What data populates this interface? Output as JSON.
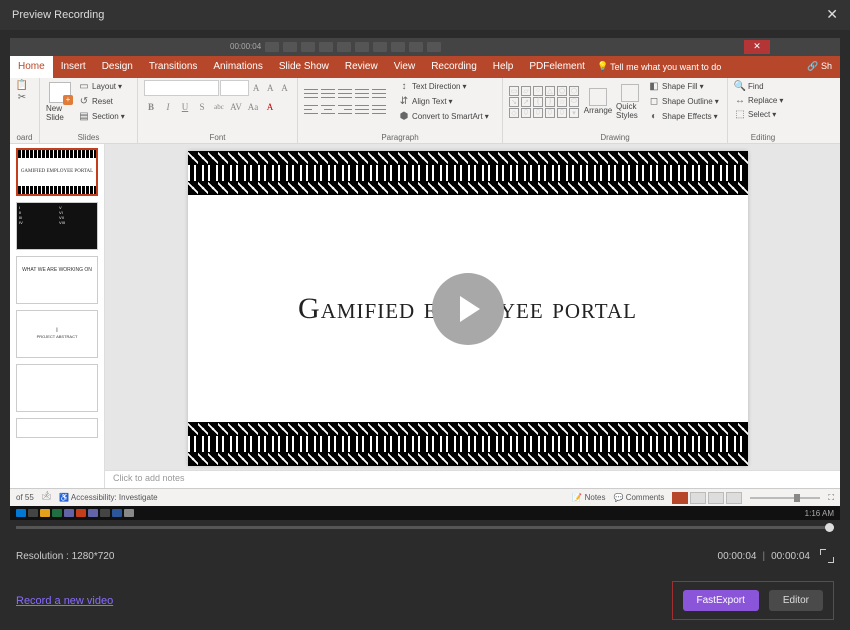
{
  "window_title": "Preview Recording",
  "pp_topbar": {
    "time": "00:00:04"
  },
  "ribbon_tabs": [
    "Home",
    "Insert",
    "Design",
    "Transitions",
    "Animations",
    "Slide Show",
    "Review",
    "View",
    "Recording",
    "Help",
    "PDFelement"
  ],
  "ribbon_tell": "Tell me what you want to do",
  "ribbon_share": "Sh",
  "ribbon": {
    "slides": {
      "new_slide": "New Slide",
      "layout": "Layout",
      "reset": "Reset",
      "section": "Section",
      "label": "Slides"
    },
    "font": {
      "label": "Font"
    },
    "paragraph": {
      "text_direction": "Text Direction",
      "align_text": "Align Text",
      "convert_smartart": "Convert to SmartArt",
      "label": "Paragraph"
    },
    "drawing": {
      "arrange": "Arrange",
      "quick": "Quick Styles",
      "shape_fill": "Shape Fill",
      "shape_outline": "Shape Outline",
      "shape_effects": "Shape Effects",
      "label": "Drawing"
    },
    "editing": {
      "find": "Find",
      "replace": "Replace",
      "select": "Select",
      "label": "Editing"
    }
  },
  "thumbs": {
    "t1": "GAMIFIED EMPLOYEE PORTAL",
    "t4_num": "I",
    "t4_label": "PROJECT ABSTRACT"
  },
  "slide_title": "Gamified employee portal",
  "notes_placeholder": "Click to add notes",
  "statusbar": {
    "slide_of": "of 55",
    "accessibility": "Accessibility: Investigate",
    "notes": "Notes",
    "comments": "Comments"
  },
  "taskbar_time": "1:16 AM",
  "resolution_label": "Resolution :",
  "resolution_value": "1280*720",
  "time_current": "00:00:04",
  "time_total": "00:00:04",
  "record_link": "Record a new video",
  "fastexport": "FastExport",
  "editor": "Editor"
}
